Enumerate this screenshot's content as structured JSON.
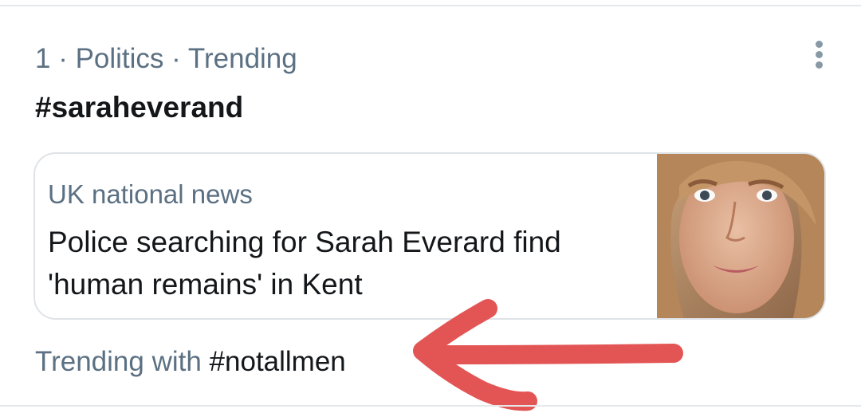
{
  "trend": {
    "meta": "1 · Politics · Trending",
    "hashtag": "#saraheverand",
    "more_icon": "more-vertical-icon"
  },
  "news_card": {
    "source": "UK national news",
    "headline": "Police searching for Sarah Everard find 'human remains' in Kent",
    "thumbnail": "portrait-photo"
  },
  "trending_with": {
    "label": "Trending with",
    "tag": "#notallmen"
  },
  "colors": {
    "secondary_text": "#5b7083",
    "primary_text": "#14171a",
    "divider": "#e6e9ec",
    "annotation_red": "#e35555"
  }
}
